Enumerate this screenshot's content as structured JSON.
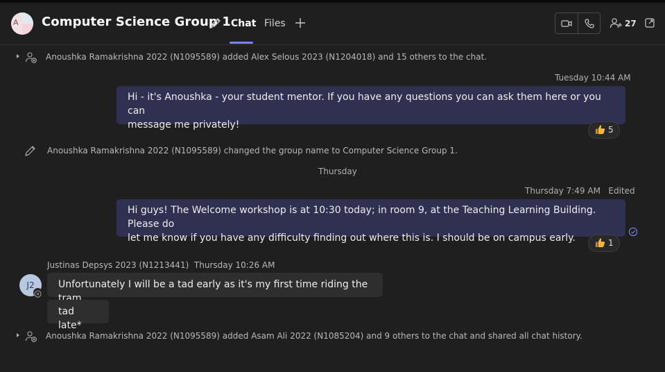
{
  "header": {
    "avatar_initials": "A",
    "title": "Computer Science Group 1",
    "tabs": [
      {
        "label": "Chat",
        "active": true
      },
      {
        "label": "Files",
        "active": false
      }
    ],
    "participants_count": "27"
  },
  "messages": {
    "sys1": "Anoushka Ramakrishna 2022 (N1095589) added Alex Selous 2023 (N1204018) and 15 others to the chat.",
    "stamp1": "Tuesday 10:44 AM",
    "msg1_line1": "Hi - it's Anoushka - your student mentor. If you have any questions you can ask them here or you can",
    "msg1_line2": "message me privately!",
    "reaction1": {
      "emoji": "thumbs-up",
      "count": "5"
    },
    "sys2": "Anoushka Ramakrishna 2022 (N1095589) changed the group name to Computer Science Group 1.",
    "day_separator": "Thursday",
    "stamp2": "Thursday 7:49 AM",
    "stamp2_edited": "Edited",
    "msg2_line1": "Hi guys! The Welcome workshop is at 10:30 today; in room 9, at the Teaching Learning Building. Please do",
    "msg2_line2": "let me know if you have any difficulty finding out where this is. I should be on campus early.",
    "reaction2": {
      "emoji": "thumbs-up",
      "count": "1"
    },
    "sender3_name": "Justinas Depsys 2023 (N1213441)",
    "sender3_time": "Thursday 10:26 AM",
    "sender3_initials": "J2",
    "msg3": "Unfortunately I will be a tad early as it's my first time riding the tram.",
    "msg4": "tad late*",
    "sys3": "Anoushka Ramakrishna 2022 (N1095589) added Asam Ali 2022 (N1085204) and 9 others to the chat and shared all chat history."
  },
  "colors": {
    "accent": "#7f85f5",
    "outgoing_bubble": "#2f3052",
    "incoming_bubble": "#2e2e2e",
    "background": "#1f1f1f"
  }
}
